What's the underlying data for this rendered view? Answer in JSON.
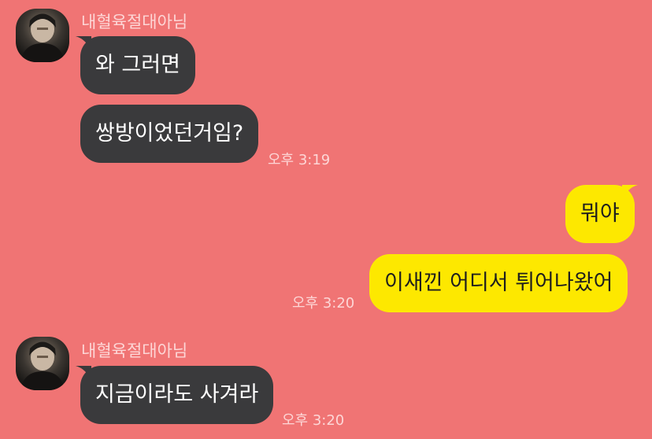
{
  "colors": {
    "background": "#f07474",
    "received_bubble": "#3a3a3c",
    "sent_bubble": "#fde800",
    "meta_text": "#fdebeb"
  },
  "messages": {
    "group1": {
      "sender": "내혈육절대아님",
      "avatar_icon": "profile-photo",
      "bubble1": "와 그러면",
      "bubble2": "쌍방이었던거임?",
      "time": "오후 3:19"
    },
    "group2": {
      "bubble1": "뭐야",
      "bubble2": "이새낀 어디서 튀어나왔어",
      "time": "오후 3:20"
    },
    "group3": {
      "sender": "내혈육절대아님",
      "avatar_icon": "profile-photo",
      "bubble1": "지금이라도 사겨라",
      "time": "오후 3:20"
    }
  }
}
